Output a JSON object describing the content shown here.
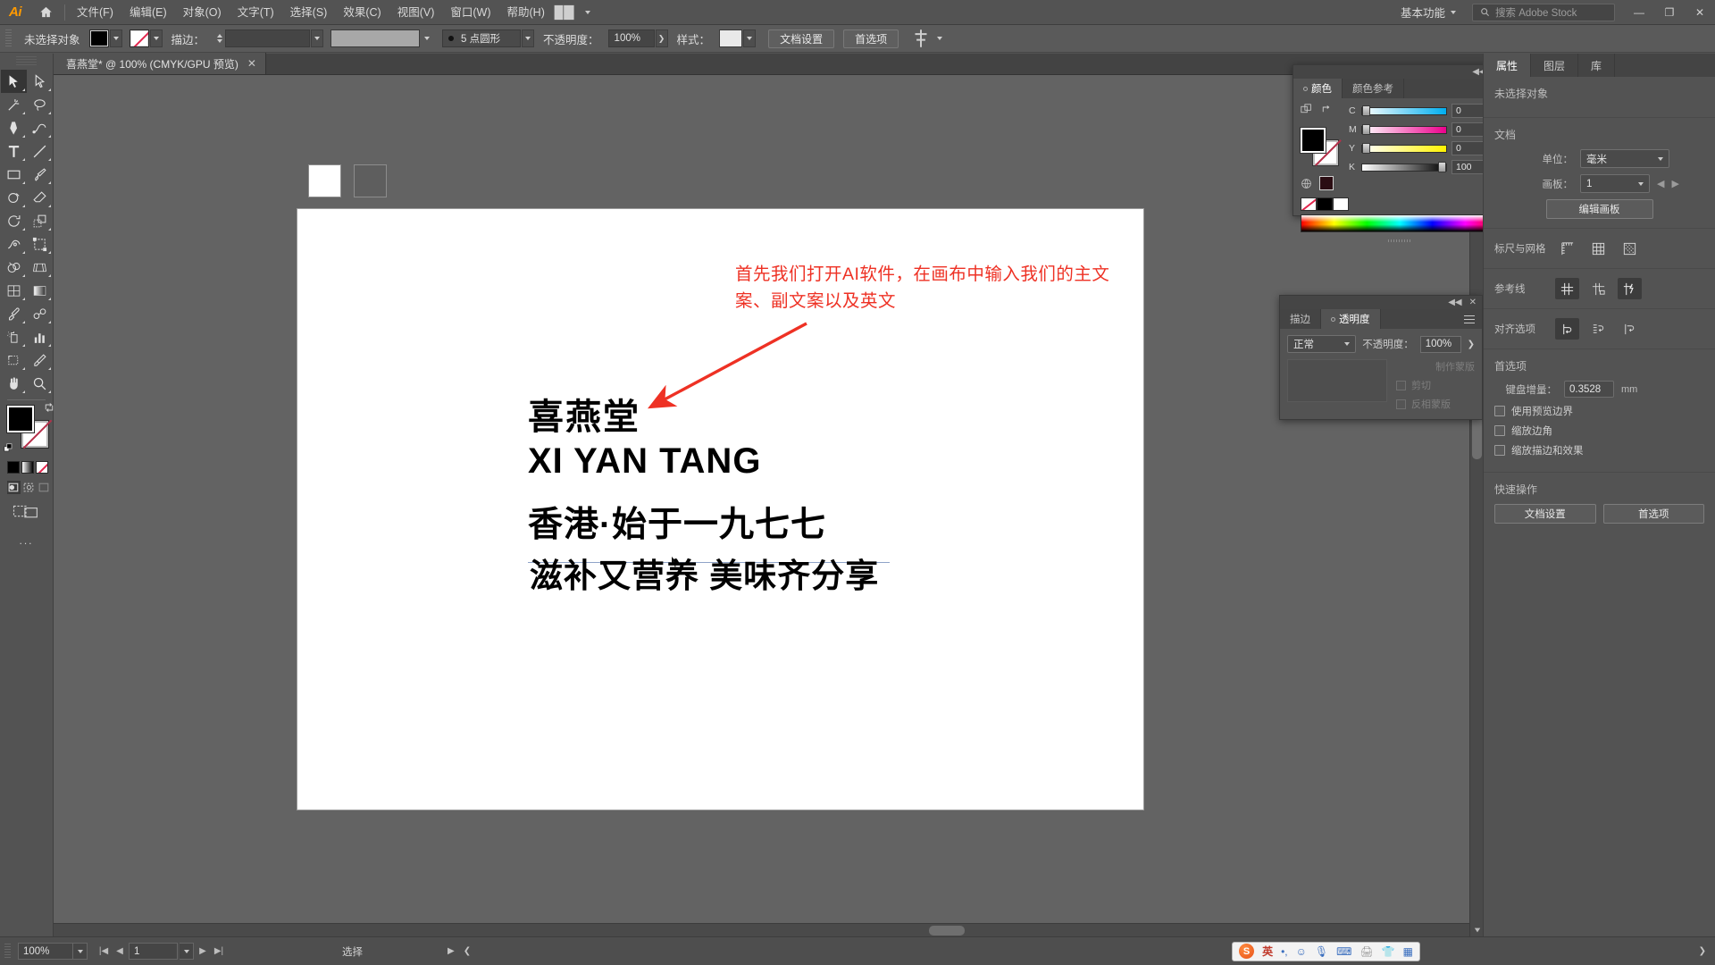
{
  "app": {
    "name": "Adobe Illustrator",
    "logo_text": "Ai"
  },
  "menubar": {
    "items": [
      {
        "label": "文件(F)"
      },
      {
        "label": "编辑(E)"
      },
      {
        "label": "对象(O)"
      },
      {
        "label": "文字(T)"
      },
      {
        "label": "选择(S)"
      },
      {
        "label": "效果(C)"
      },
      {
        "label": "视图(V)"
      },
      {
        "label": "窗口(W)"
      },
      {
        "label": "帮助(H)"
      }
    ],
    "workspace": "基本功能",
    "search_placeholder": "搜索 Adobe Stock",
    "win_minimize": "—",
    "win_restore": "❐",
    "win_close": "✕"
  },
  "controlbar": {
    "selection_status": "未选择对象",
    "stroke_label": "描边：",
    "stroke_weight": "5 点圆形",
    "opacity_label": "不透明度：",
    "opacity_value": "100%",
    "style_label": "样式：",
    "doc_setup_button": "文档设置",
    "preferences_button": "首选项",
    "fill_color": "#000000",
    "stroke_color": "none"
  },
  "toolbar": {
    "tools": [
      {
        "name": "selection-tool",
        "key": "V"
      },
      {
        "name": "direct-selection-tool",
        "key": "A"
      },
      {
        "name": "magic-wand-tool",
        "key": "Y"
      },
      {
        "name": "lasso-tool",
        "key": "Q"
      },
      {
        "name": "pen-tool",
        "key": "P"
      },
      {
        "name": "curvature-tool",
        "key": "Shift+~"
      },
      {
        "name": "type-tool",
        "key": "T"
      },
      {
        "name": "line-segment-tool",
        "key": "\\"
      },
      {
        "name": "rectangle-tool",
        "key": "M"
      },
      {
        "name": "paintbrush-tool",
        "key": "B"
      },
      {
        "name": "shaper-tool",
        "key": "Shift+N"
      },
      {
        "name": "eraser-tool",
        "key": "Shift+E"
      },
      {
        "name": "rotate-tool",
        "key": "R"
      },
      {
        "name": "scale-tool",
        "key": "S"
      },
      {
        "name": "width-tool",
        "key": "Shift+W"
      },
      {
        "name": "free-transform-tool",
        "key": "E"
      },
      {
        "name": "shape-builder-tool",
        "key": "Shift+M"
      },
      {
        "name": "perspective-grid-tool",
        "key": "Shift+P"
      },
      {
        "name": "mesh-tool",
        "key": "U"
      },
      {
        "name": "gradient-tool",
        "key": "G"
      },
      {
        "name": "eyedropper-tool",
        "key": "I"
      },
      {
        "name": "blend-tool",
        "key": "W"
      },
      {
        "name": "symbol-sprayer-tool",
        "key": "Shift+S"
      },
      {
        "name": "column-graph-tool",
        "key": "J"
      },
      {
        "name": "artboard-tool",
        "key": "Shift+O"
      },
      {
        "name": "slice-tool",
        "key": "Shift+K"
      },
      {
        "name": "hand-tool",
        "key": "H"
      },
      {
        "name": "zoom-tool",
        "key": "Z"
      }
    ],
    "fill_color": "#000000",
    "stroke_color": "none",
    "color_modes": [
      "color",
      "gradient",
      "none"
    ],
    "screen_modes": [
      "normal-screen-mode",
      "full-screen-with-menubar",
      "full-screen"
    ],
    "edit_toolbar": "..."
  },
  "document_tab": {
    "title": "喜燕堂* @ 100% (CMYK/GPU 预览)",
    "close": "✕"
  },
  "canvas": {
    "annotation": "首先我们打开AI软件，在画布中输入我们的主文案、副文案以及英文",
    "annotation_color": "#ee3124",
    "artboard_lines": [
      "喜燕堂",
      "XI YAN TANG",
      "香港·始于一九七七",
      "滋补又营养 美味齐分享"
    ],
    "swatch_white": "#ffffff",
    "swatch_gray": "#5e5e5e"
  },
  "color_panel": {
    "tabs": [
      {
        "label": "颜色",
        "selected": true
      },
      {
        "label": "颜色参考",
        "selected": false
      }
    ],
    "channels": [
      {
        "label": "C",
        "value": "0",
        "unit": "%"
      },
      {
        "label": "M",
        "value": "0",
        "unit": "%"
      },
      {
        "label": "Y",
        "value": "0",
        "unit": "%"
      },
      {
        "label": "K",
        "value": "100",
        "unit": "%"
      }
    ],
    "collapse": "◀◀",
    "close": "✕"
  },
  "transparency_panel": {
    "tabs": [
      {
        "label": "描边",
        "selected": false
      },
      {
        "label": "透明度",
        "selected": true
      }
    ],
    "blend_mode": "正常",
    "opacity_label": "不透明度：",
    "opacity_value": "100%",
    "make_mask": "制作蒙版",
    "clip": "剪切",
    "invert_mask": "反相蒙版",
    "collapse": "◀◀",
    "close": "✕"
  },
  "properties_panel": {
    "tabs": [
      {
        "label": "属性",
        "selected": true
      },
      {
        "label": "图层",
        "selected": false
      },
      {
        "label": "库",
        "selected": false
      }
    ],
    "no_selection": "未选择对象",
    "document_section": {
      "title": "文档",
      "unit_label": "单位：",
      "unit_value": "毫米",
      "artboard_label": "画板：",
      "artboard_value": "1",
      "edit_artboards_button": "编辑画板"
    },
    "rulers_grids": {
      "label": "标尺与网格"
    },
    "guides": {
      "label": "参考线"
    },
    "snap_options": {
      "label": "对齐选项"
    },
    "preferences_section": {
      "title": "首选项",
      "keyboard_increment_label": "键盘增量：",
      "keyboard_increment_value": "0.3528",
      "keyboard_increment_unit": "mm",
      "checkboxes": [
        {
          "label": "使用预览边界",
          "checked": false
        },
        {
          "label": "缩放边角",
          "checked": false
        },
        {
          "label": "缩放描边和效果",
          "checked": false
        }
      ]
    },
    "quick_actions": {
      "title": "快速操作",
      "buttons": [
        "文档设置",
        "首选项"
      ]
    }
  },
  "statusbar": {
    "zoom_value": "100%",
    "page_value": "1",
    "tool_status": "选择",
    "ime": {
      "logo": "S",
      "mode": "英",
      "items": [
        "smiley-icon",
        "microphone-icon",
        "keyboard-icon",
        "printer-icon",
        "shirt-icon",
        "apps-icon"
      ]
    }
  }
}
